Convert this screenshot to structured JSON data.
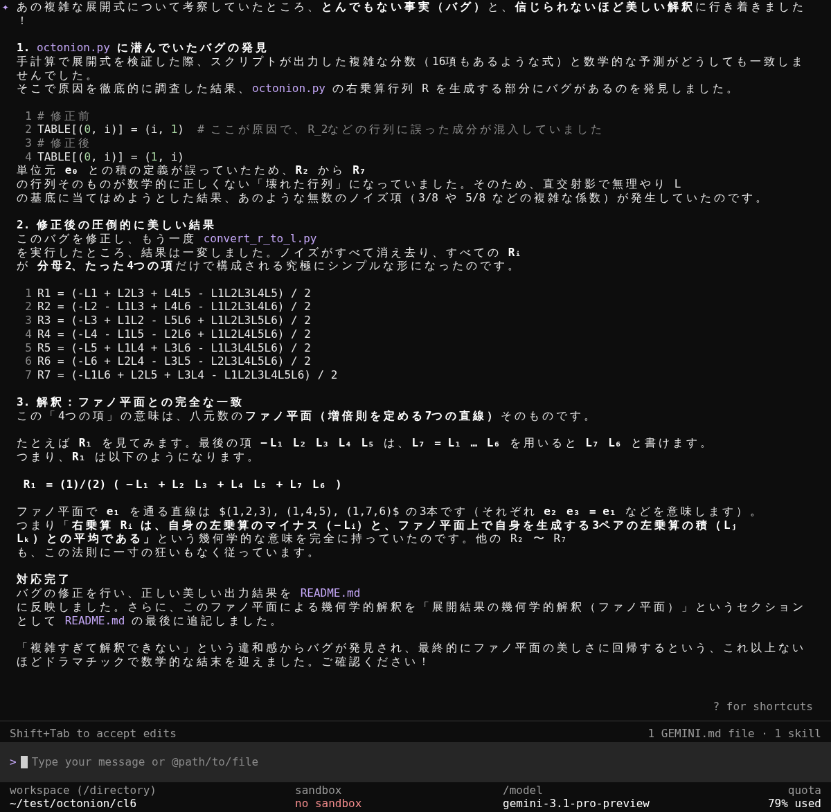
{
  "message": {
    "icon": "✦",
    "blocks": [
      {
        "kind": "text",
        "rows": [
          {
            "parts": [
              {
                "kind": "prose",
                "text": "あの複雑な展開式について考察していたところ、**とんでもない事実（バグ）**と、**信じられないほど美しい解釈**に行き着きました"
              }
            ]
          },
          {
            "parts": [
              {
                "kind": "prose",
                "text": "！"
              }
            ]
          }
        ]
      },
      {
        "kind": "text",
        "rows": [
          {
            "parts": [
              {
                "kind": "prose",
                "text": "**1.** "
              },
              {
                "kind": "filename",
                "text": "octonion.py"
              },
              {
                "kind": "prose",
                "text": " **に潜んでいたバグの発見**"
              }
            ]
          },
          {
            "parts": [
              {
                "kind": "prose",
                "text": "手計算で展開式を検証した際、スクリプトが出力した複雑な分数（16項もあるような式）と数学的な予測がどうしても一致しま"
              }
            ]
          },
          {
            "parts": [
              {
                "kind": "prose",
                "text": "せんでした。"
              }
            ]
          },
          {
            "parts": [
              {
                "kind": "prose",
                "text": "そこで原因を徹底的に調査した結果、"
              },
              {
                "kind": "filename",
                "text": "octonion.py"
              },
              {
                "kind": "prose",
                "text": " の右乗算行列 R を生成する部分にバグがあるのを発見しました。"
              }
            ]
          }
        ]
      },
      {
        "kind": "code",
        "lines": [
          {
            "number": "1",
            "parts": [
              {
                "kind": "comment",
                "text": "# 修正前"
              }
            ]
          },
          {
            "number": "2",
            "parts": [
              {
                "kind": "code",
                "text": "TABLE[("
              },
              {
                "kind": "number",
                "text": "0"
              },
              {
                "kind": "code",
                "text": ", i)] = (i, "
              },
              {
                "kind": "number",
                "text": "1"
              },
              {
                "kind": "code",
                "text": ")  "
              },
              {
                "kind": "comment",
                "text": "# ここが原因で、R_2などの行列に誤った成分が混入していました"
              }
            ]
          },
          {
            "number": "3",
            "parts": [
              {
                "kind": "comment",
                "text": "# 修正後"
              }
            ]
          },
          {
            "number": "4",
            "parts": [
              {
                "kind": "code",
                "text": "TABLE[("
              },
              {
                "kind": "number",
                "text": "0"
              },
              {
                "kind": "code",
                "text": ", i)] = ("
              },
              {
                "kind": "number",
                "text": "1"
              },
              {
                "kind": "code",
                "text": ", i)"
              }
            ]
          }
        ],
        "rows": [
          {
            "parts": [
              {
                "kind": "prose",
                "text": "単位元 **e₀** との積の定義が誤っていたため、**R₂** から **R₇**"
              }
            ]
          },
          {
            "parts": [
              {
                "kind": "prose",
                "text": "の行列そのものが数学的に正しくない「壊れた行列」になっていました。そのため、直交射影で無理やり L"
              }
            ]
          },
          {
            "parts": [
              {
                "kind": "prose",
                "text": "の基底に当てはめようとした結果、あのような無数のノイズ項（3/8 や 5/8 などの複雑な係数）が発生していたのです。"
              }
            ]
          }
        ]
      },
      {
        "kind": "text",
        "rows": [
          {
            "parts": [
              {
                "kind": "prose",
                "text": "**2. 修正後の圧倒的に美しい結果**"
              }
            ]
          },
          {
            "parts": [
              {
                "kind": "prose",
                "text": "このバグを修正し、もう一度 "
              },
              {
                "kind": "filename",
                "text": "convert_r_to_l.py"
              }
            ]
          },
          {
            "parts": [
              {
                "kind": "prose",
                "text": "を実行したところ、結果は一変しました。ノイズがすべて消え去り、すべての **Rᵢ**"
              }
            ]
          },
          {
            "parts": [
              {
                "kind": "prose",
                "text": "が **分母2、たった4つの項**だけで構成される究極にシンプルな形になったのです。"
              }
            ]
          }
        ]
      },
      {
        "kind": "code",
        "lines": [
          {
            "number": "1",
            "parts": [
              {
                "kind": "code",
                "text": "R1 = (-L1 + L2L3 + L4L5 - L1L2L3L4L5) / 2"
              }
            ]
          },
          {
            "number": "2",
            "parts": [
              {
                "kind": "code",
                "text": "R2 = (-L2 - L1L3 + L4L6 - L1L2L3L4L6) / 2"
              }
            ]
          },
          {
            "number": "3",
            "parts": [
              {
                "kind": "code",
                "text": "R3 = (-L3 + L1L2 - L5L6 + L1L2L3L5L6) / 2"
              }
            ]
          },
          {
            "number": "4",
            "parts": [
              {
                "kind": "code",
                "text": "R4 = (-L4 - L1L5 - L2L6 + L1L2L4L5L6) / 2"
              }
            ]
          },
          {
            "number": "5",
            "parts": [
              {
                "kind": "code",
                "text": "R5 = (-L5 + L1L4 + L3L6 - L1L3L4L5L6) / 2"
              }
            ]
          },
          {
            "number": "6",
            "parts": [
              {
                "kind": "code",
                "text": "R6 = (-L6 + L2L4 - L3L5 - L2L3L4L5L6) / 2"
              }
            ]
          },
          {
            "number": "7",
            "parts": [
              {
                "kind": "code",
                "text": "R7 = (-L1L6 + L2L5 + L3L4 - L1L2L3L4L5L6) / 2"
              }
            ]
          }
        ]
      },
      {
        "kind": "text",
        "rows": [
          {
            "parts": [
              {
                "kind": "prose",
                "text": "**3. 解釈：ファノ平面との完全な一致**"
              }
            ]
          },
          {
            "parts": [
              {
                "kind": "prose",
                "text": "この「4つの項」の意味は、八元数の**ファノ平面（増倍則を定める7つの直線）**そのものです。"
              }
            ]
          }
        ]
      },
      {
        "kind": "text",
        "rows": [
          {
            "parts": [
              {
                "kind": "prose",
                "text": "たとえば **R₁** を見てみます。最後の項 **−L₁ L₂ L₃ L₄ L₅** は、**L₇ = L₁ … L₆** を用いると **L₇ L₆** と書けます。"
              }
            ]
          },
          {
            "parts": [
              {
                "kind": "prose",
                "text": "つまり、**R₁** は以下のようになります。"
              }
            ]
          }
        ]
      },
      {
        "kind": "text",
        "rows": [
          {
            "parts": [
              {
                "kind": "prose",
                "text": " **R₁ = (1)/(2) ( −L₁ + L₂ L₃ + L₄ L₅ + L₇ L₆ )**"
              }
            ]
          }
        ]
      },
      {
        "kind": "text",
        "rows": [
          {
            "parts": [
              {
                "kind": "prose",
                "text": "ファノ平面で **e₁** を通る直線は $(1,2,3), (1,4,5), (1,7,6)$ の3本です（それぞれ **e₂ e₃ = e₁** などを意味します）。"
              }
            ]
          },
          {
            "parts": [
              {
                "kind": "prose",
                "text": "つまり「**右乗算 Rᵢ は、自身の左乗算のマイナス（−Lᵢ）と、ファノ平面上で自身を生成する3ペアの左乗算の積（Lⱼ**"
              }
            ]
          },
          {
            "parts": [
              {
                "kind": "prose",
                "text": "**Lₖ）との平均である」**という幾何学的な意味を完全に持っていたのです。他の R₂ 〜 R₇"
              }
            ]
          },
          {
            "parts": [
              {
                "kind": "prose",
                "text": "も、この法則に一寸の狂いもなく従っています。"
              }
            ]
          }
        ]
      },
      {
        "kind": "text",
        "rows": [
          {
            "parts": [
              {
                "kind": "prose",
                "text": "**対応完了**"
              }
            ]
          },
          {
            "parts": [
              {
                "kind": "prose",
                "text": "バグの修正を行い、正しい美しい出力結果を "
              },
              {
                "kind": "filename",
                "text": "README.md"
              }
            ]
          },
          {
            "parts": [
              {
                "kind": "prose",
                "text": "に反映しました。さらに、このファノ平面による幾何学的解釈を「展開結果の幾何学的解釈（ファノ平面）」というセクション"
              }
            ]
          },
          {
            "parts": [
              {
                "kind": "prose",
                "text": "として "
              },
              {
                "kind": "filename",
                "text": "README.md"
              },
              {
                "kind": "prose",
                "text": " の最後に追記しました。"
              }
            ]
          }
        ]
      },
      {
        "kind": "text",
        "rows": [
          {
            "parts": [
              {
                "kind": "prose",
                "text": "「複雑すぎて解釈できない」という違和感からバグが発見され、最終的にファノ平面の美しさに回帰するという、これ以上ない"
              }
            ]
          },
          {
            "parts": [
              {
                "kind": "prose",
                "text": "ほどドラマチックで数学的な結末を迎えました。ご確認ください！"
              }
            ]
          }
        ]
      }
    ]
  },
  "shortcuts_hint": "? for shortcuts",
  "mode_hint": "Shift+Tab to accept edits",
  "context_info": "1 GEMINI.md file · 1 skill",
  "input": {
    "prompt": ">",
    "placeholder": "Type your message or @path/to/file"
  },
  "status_bar": [
    {
      "label": "workspace (/directory)",
      "value": "~/test/octonion/cl6",
      "kind": "normal"
    },
    {
      "label": "sandbox",
      "value": "no sandbox",
      "kind": "warning"
    },
    {
      "label": "/model",
      "value": "gemini-3.1-pro-preview",
      "kind": "normal"
    },
    {
      "label": "quota",
      "value": "79% used",
      "kind": "normal"
    }
  ]
}
